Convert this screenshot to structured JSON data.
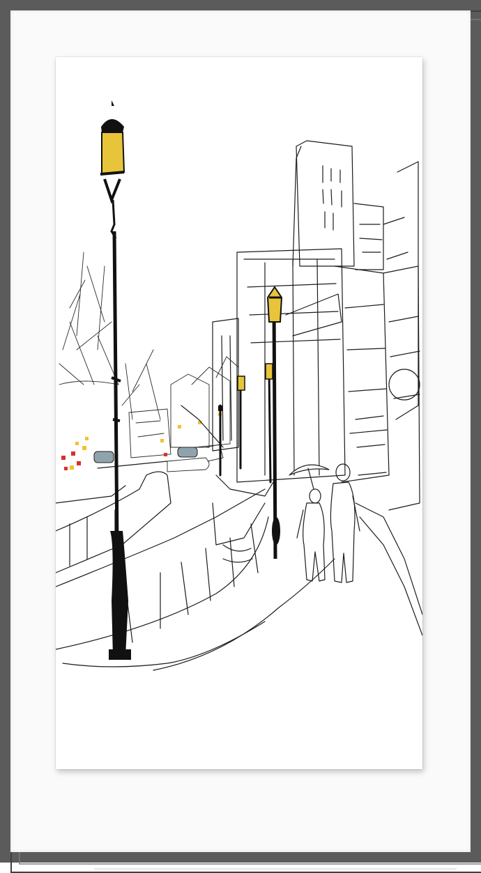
{
  "artwork": {
    "subject": "city-street-sketch",
    "medium_icon": "lamp-post-icon"
  },
  "colors": {
    "frame": "#5b5b5b",
    "mat": "#fafafa",
    "canvas": "#ffffff",
    "ink": "#1b1b1b",
    "lamp_glow": "#e8c43a",
    "accent_red": "#d9302a",
    "accent_yellow": "#f1c232",
    "car_blue": "#8fa3ad"
  }
}
